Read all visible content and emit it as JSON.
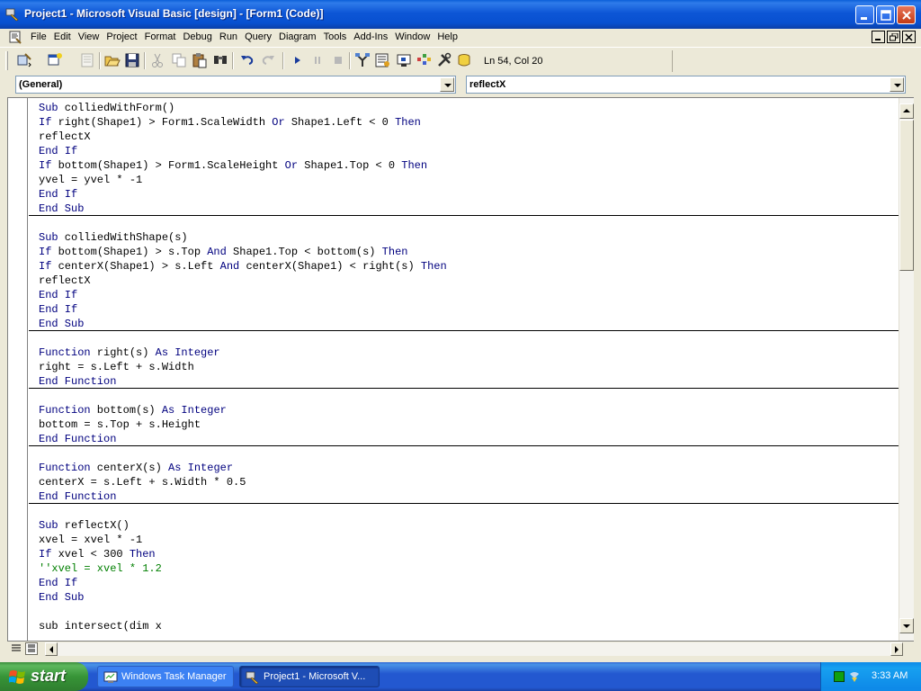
{
  "window": {
    "title": "Project1 - Microsoft Visual Basic [design] - [Form1 (Code)]"
  },
  "menu": [
    "File",
    "Edit",
    "View",
    "Project",
    "Format",
    "Debug",
    "Run",
    "Query",
    "Diagram",
    "Tools",
    "Add-Ins",
    "Window",
    "Help"
  ],
  "toolbar": {
    "cursor_position": "Ln 54, Col 20",
    "icons": [
      "add-project-icon",
      "add-form-icon",
      "menu-editor-icon",
      "open-icon",
      "save-icon",
      "cut-icon",
      "copy-icon",
      "paste-icon",
      "find-icon",
      "undo-icon",
      "redo-icon",
      "run-icon",
      "pause-icon",
      "stop-icon",
      "project-explorer-icon",
      "properties-icon",
      "form-layout-icon",
      "object-browser-icon",
      "toolbox-icon",
      "data-view-icon"
    ]
  },
  "object_combo": {
    "value": "(General)"
  },
  "procedure_combo": {
    "value": "reflectX"
  },
  "code_lines": [
    [
      "Sub colliedWithForm()"
    ],
    [
      "If right(Shape1) > Form1.ScaleWidth Or Shape1.Left < 0 Then"
    ],
    [
      "reflectX"
    ],
    [
      "End If"
    ],
    [
      "If bottom(Shape1) > Form1.ScaleHeight Or Shape1.Top < 0 Then"
    ],
    [
      "yvel = yvel * -1"
    ],
    [
      "End If"
    ],
    [
      "End Sub"
    ],
    [
      ""
    ],
    [
      "Sub colliedWithShape(s)"
    ],
    [
      "If bottom(Shape1) > s.Top And Shape1.Top < bottom(s) Then"
    ],
    [
      "If centerX(Shape1) > s.Left And centerX(Shape1) < right(s) Then"
    ],
    [
      "reflectX"
    ],
    [
      "End If"
    ],
    [
      "End If"
    ],
    [
      "End Sub"
    ],
    [
      ""
    ],
    [
      "Function right(s) As Integer"
    ],
    [
      "right = s.Left + s.Width"
    ],
    [
      "End Function"
    ],
    [
      ""
    ],
    [
      "Function bottom(s) As Integer"
    ],
    [
      "bottom = s.Top + s.Height"
    ],
    [
      "End Function"
    ],
    [
      ""
    ],
    [
      "Function centerX(s) As Integer"
    ],
    [
      "centerX = s.Left + s.Width * 0.5"
    ],
    [
      "End Function"
    ],
    [
      ""
    ],
    [
      "Sub reflectX()"
    ],
    [
      "xvel = xvel * -1"
    ],
    [
      "If xvel < 300 Then"
    ],
    [
      "''xvel = xvel * 1.2"
    ],
    [
      "End If"
    ],
    [
      "End Sub"
    ],
    [
      ""
    ],
    [
      "sub intersect(dim x"
    ]
  ],
  "taskbar": {
    "start_label": "start",
    "tasks": [
      "Windows Task Manager",
      "Project1 - Microsoft V..."
    ],
    "clock": "3:33 AM"
  },
  "colors": {
    "keyword": "#00007F",
    "comment": "#007F00",
    "titlebar": "#0A5FD8"
  }
}
